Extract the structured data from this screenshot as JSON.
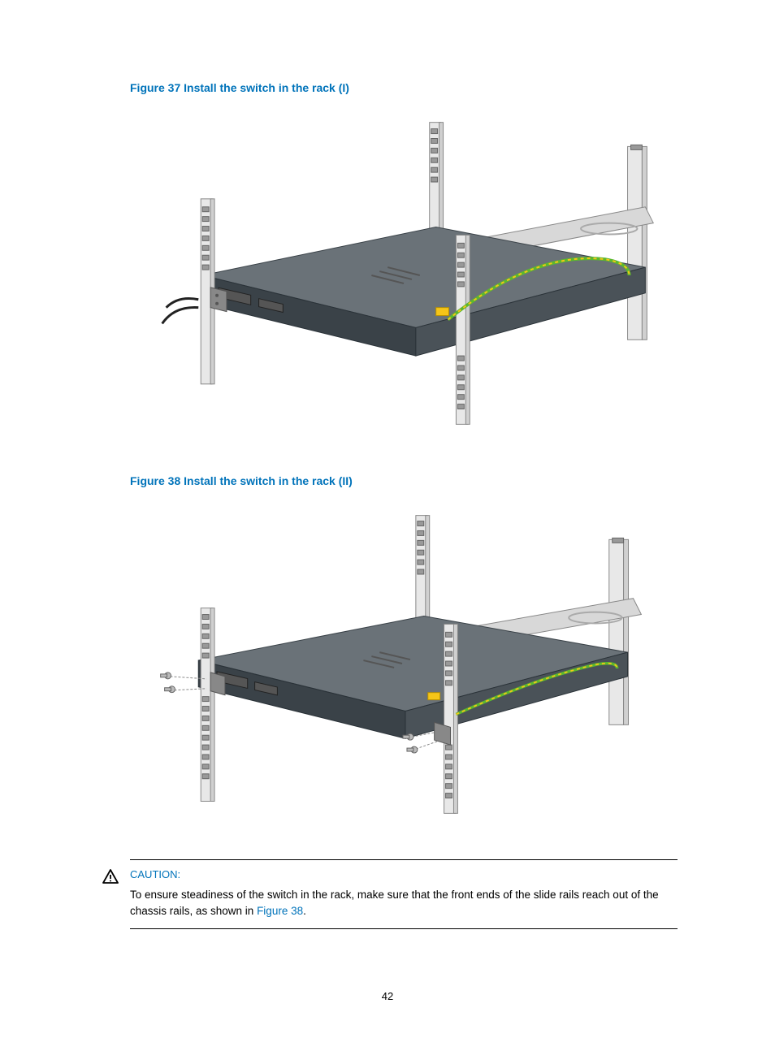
{
  "figures": {
    "fig37": {
      "caption": "Figure 37 Install the switch in the rack (I)"
    },
    "fig38": {
      "caption": "Figure 38 Install the switch in the rack (II)"
    }
  },
  "caution": {
    "label": "CAUTION:",
    "text_before": "To ensure steadiness of the switch in the rack, make sure that the front ends of the slide rails reach out of the chassis rails, as shown in ",
    "link_text": "Figure 38",
    "text_after": "."
  },
  "page_number": "42"
}
